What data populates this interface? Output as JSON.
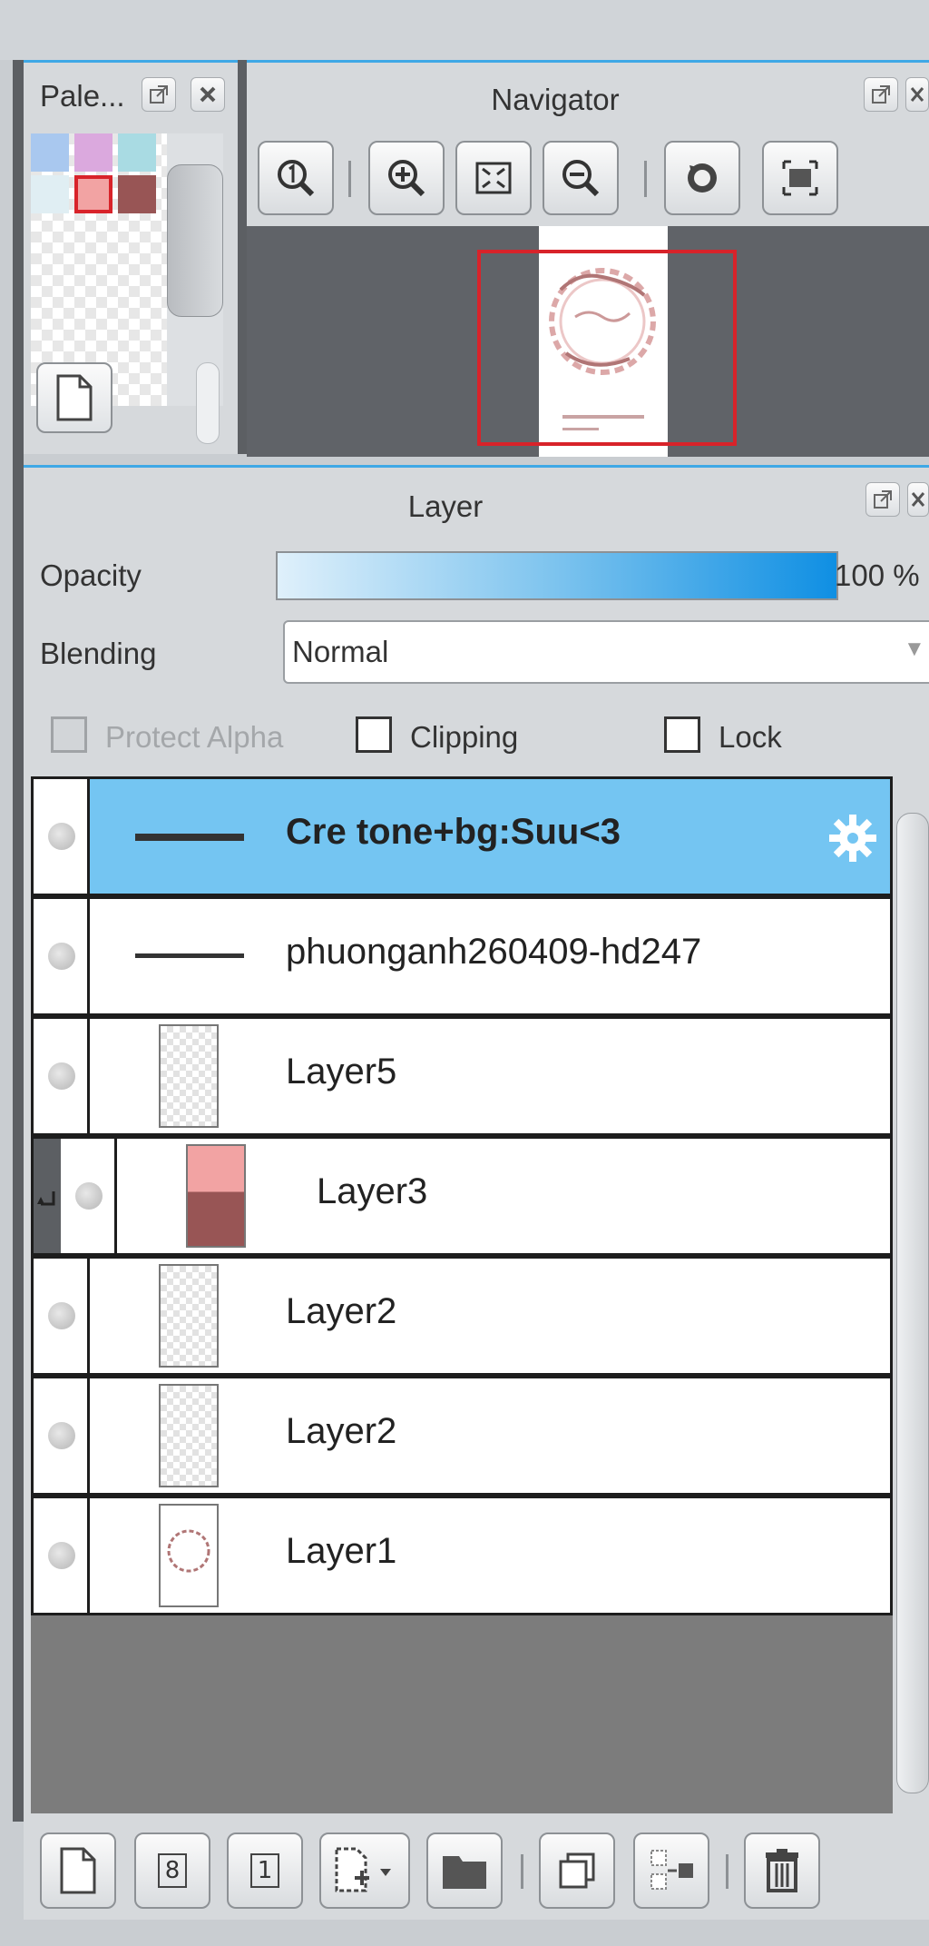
{
  "palette": {
    "title": "Pale...",
    "swatches": [
      "#a9c8ef",
      "#dba9de",
      "#a9dbe3",
      "#e0eef3",
      "#f2a3a3",
      "#985555"
    ],
    "selected_swatch": 4
  },
  "navigator": {
    "title": "Navigator",
    "tools": [
      "zoom-actual-icon",
      "zoom-in-icon",
      "fit-window-icon",
      "zoom-out-icon",
      "rotate-icon",
      "fullscreen-icon"
    ]
  },
  "layer_panel": {
    "title": "Layer",
    "opacity_label": "Opacity",
    "opacity_value": "100 %",
    "opacity_fraction": 1.0,
    "blending_label": "Blending",
    "blending_value": "Normal",
    "protect_alpha_label": "Protect Alpha",
    "clipping_label": "Clipping",
    "lock_label": "Lock",
    "layers": [
      {
        "name": "Cre tone+bg:Suu<3",
        "selected": true
      },
      {
        "name": "phuonganh260409-hd247",
        "selected": false
      },
      {
        "name": "Layer5",
        "selected": false
      },
      {
        "name": "Layer3",
        "selected": false,
        "clipped": true
      },
      {
        "name": "Layer2",
        "selected": false
      },
      {
        "name": "Layer2",
        "selected": false
      },
      {
        "name": "Layer1",
        "selected": false
      }
    ],
    "toolbar": {
      "new_layer_8bit": "8",
      "new_layer_1bit": "1"
    }
  },
  "colors": {
    "accent": "#3fa8e6",
    "selection": "#74c5f2",
    "viewport_frame": "#d8232a"
  }
}
